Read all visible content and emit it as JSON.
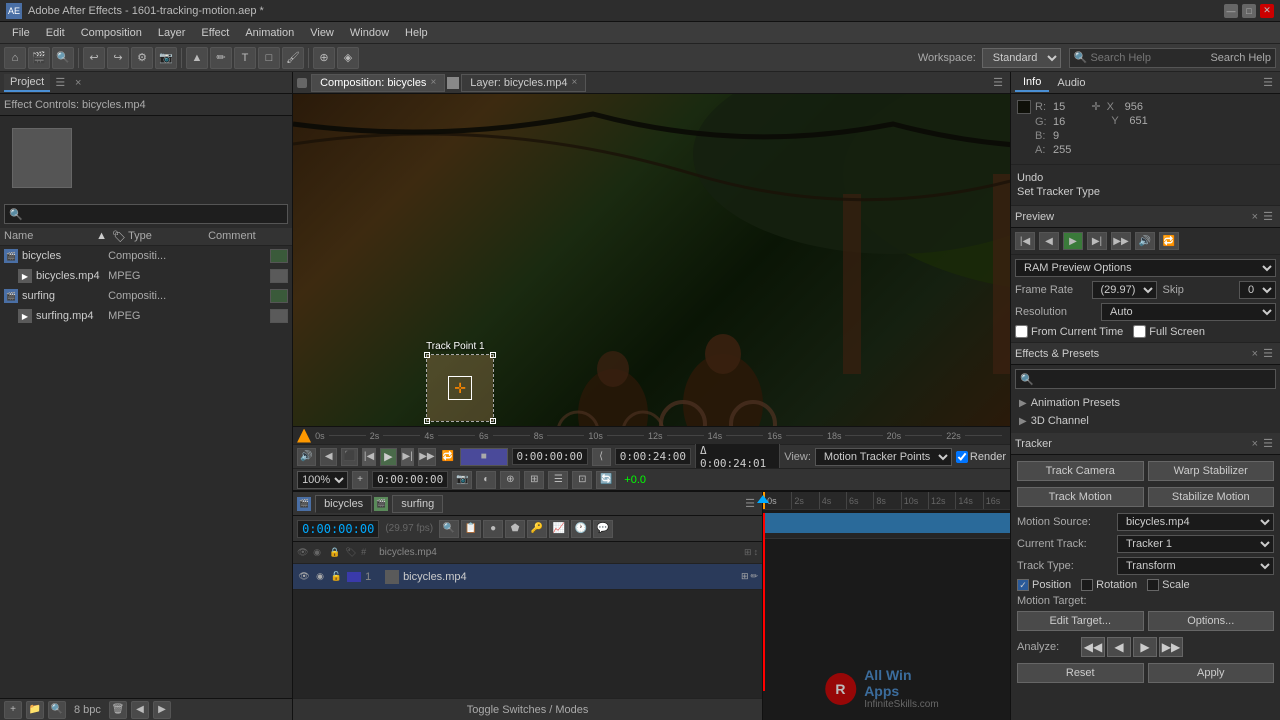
{
  "app": {
    "title": "Adobe After Effects - 1601-tracking-motion.aep *",
    "icon": "AE"
  },
  "title_buttons": {
    "minimize": "—",
    "maximize": "□",
    "close": "✕"
  },
  "menu": {
    "items": [
      "File",
      "Edit",
      "Composition",
      "Layer",
      "Effect",
      "Animation",
      "View",
      "Window",
      "Help"
    ]
  },
  "toolbar": {
    "workspace_label": "Workspace:",
    "workspace_value": "Standard",
    "search_placeholder": "Search Help",
    "search_label": "Search Help"
  },
  "left_panel": {
    "tab": "Project",
    "close": "×",
    "effect_controls_label": "Effect Controls: bicycles.mp4",
    "search_placeholder": "🔍",
    "columns": {
      "name": "Name",
      "type": "Type",
      "comment": "Comment"
    },
    "items": [
      {
        "name": "bicycles",
        "type": "Compositi...",
        "comment": "",
        "icon": "comp"
      },
      {
        "name": "bicycles.mp4",
        "type": "MPEG",
        "comment": "",
        "icon": "mpeg"
      },
      {
        "name": "surfing",
        "type": "Compositi...",
        "comment": "",
        "icon": "comp"
      },
      {
        "name": "surfing.mp4",
        "type": "MPEG",
        "comment": "",
        "icon": "mpeg"
      }
    ],
    "footer": {
      "bpc": "8 bpc"
    }
  },
  "viewer": {
    "tabs": [
      {
        "label": "Composition: bicycles",
        "active": true
      },
      {
        "label": "Layer: bicycles.mp4",
        "active": false
      }
    ],
    "track_point_label": "Track Point 1",
    "view_options": {
      "label": "View:",
      "value": "Motion Tracker Points"
    },
    "render_label": "Render",
    "timeline": {
      "current_time": "0:00:00:00",
      "duration": "0:00:24:00",
      "delta": "Δ 0:00:24:01",
      "zoom": "100%",
      "current_code": "0:00:00:00",
      "offset": "+0.0"
    }
  },
  "right_panel": {
    "tabs": [
      "Info",
      "Audio"
    ],
    "info": {
      "r_label": "R:",
      "r_val": "15",
      "g_label": "G:",
      "g_val": "16",
      "b_label": "B:",
      "b_val": "9",
      "a_label": "A:",
      "a_val": "255",
      "x_label": "X",
      "x_val": "956",
      "y_label": "Y",
      "y_val": "651"
    },
    "undo": {
      "undo_label": "Undo",
      "set_tracker_label": "Set Tracker Type"
    },
    "preview": {
      "label": "Preview",
      "close": "×",
      "options_label": "RAM Preview Options",
      "frame_rate_label": "Frame Rate",
      "frame_rate_val": "(29.97)",
      "skip_label": "Skip",
      "skip_val": "0",
      "resolution_label": "Resolution",
      "resolution_val": "Auto",
      "from_current_label": "From Current Time",
      "full_screen_label": "Full Screen"
    },
    "effects_presets": {
      "label": "Effects & Presets",
      "close": "×",
      "search_placeholder": "🔍",
      "categories": [
        {
          "name": "Animation Presets",
          "expanded": true
        },
        {
          "name": "3D Channel",
          "expanded": false
        }
      ]
    },
    "tracker": {
      "label": "Tracker",
      "close": "×",
      "track_camera_btn": "Track Camera",
      "warp_stabilizer_btn": "Warp Stabilizer",
      "track_motion_btn": "Track Motion",
      "stabilize_motion_btn": "Stabilize Motion",
      "motion_source_label": "Motion Source:",
      "motion_source_val": "bicycles.mp4",
      "current_track_label": "Current Track:",
      "current_track_val": "Tracker 1",
      "track_type_label": "Track Type:",
      "track_type_val": "Transform",
      "position_label": "Position",
      "rotation_label": "Rotation",
      "scale_label": "Scale",
      "motion_target_label": "Motion Target:",
      "edit_target_btn": "Edit Target...",
      "options_btn": "Options...",
      "analyze_label": "Analyze:",
      "analyze_btns": [
        "◀◀",
        "◀",
        "▶",
        "▶▶"
      ],
      "reset_btn": "Reset",
      "apply_btn": "Apply"
    }
  },
  "timeline": {
    "tabs": [
      "bicycles",
      "surfing"
    ],
    "active_tab": "bicycles",
    "current_time": "0:00:00:00",
    "fps": "(29.97 fps)",
    "layer": {
      "num": "1",
      "name": "bicycles.mp4",
      "switches": [
        "eye",
        "solo",
        "lock",
        "color",
        "fx",
        "motion-blur",
        "3d"
      ]
    },
    "ruler_marks": [
      "0s",
      "2s",
      "4s",
      "6s",
      "8s",
      "10s",
      "12s",
      "14s",
      "16s"
    ],
    "bottom_bar": "Toggle Switches / Modes"
  }
}
